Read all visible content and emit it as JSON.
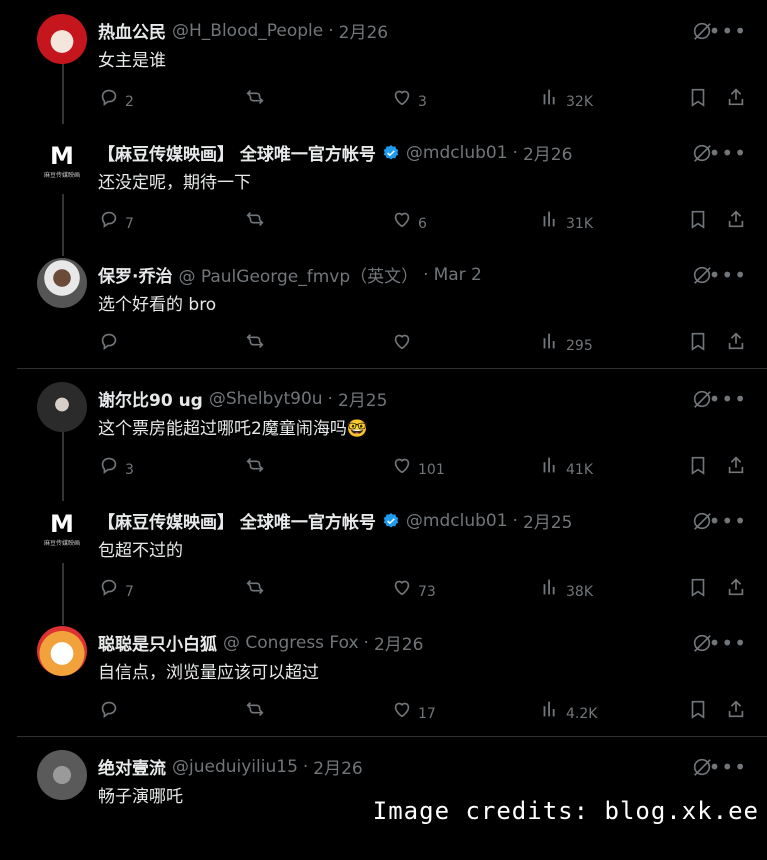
{
  "groups": [
    {
      "tweets": [
        {
          "name": "热血公民",
          "handle": "@H_Blood_People",
          "date": "2月26",
          "text": "女主是谁",
          "verified": false,
          "avatar": "red-rabbit-avatar",
          "reply": "2",
          "retweet": "",
          "like": "3",
          "views": "32K"
        },
        {
          "name": "【麻豆传媒映画】 全球唯一官方帐号",
          "handle": "@mdclub01",
          "date": "2月26",
          "text": "还没定呢，期待一下",
          "verified": true,
          "avatar": "madou-logo",
          "reply": "7",
          "retweet": "",
          "like": "6",
          "views": "31K"
        },
        {
          "name": "保罗·乔治",
          "handle": "@ PaulGeorge_fmvp（英文）",
          "date": "Mar 2",
          "text": "选个好看的 bro",
          "verified": false,
          "avatar": "man-photo-avatar",
          "reply": "",
          "retweet": "",
          "like": "",
          "views": "295"
        }
      ]
    },
    {
      "tweets": [
        {
          "name": "谢尔比90 ug",
          "handle": "@Shelbyt90u",
          "date": "2月25",
          "text": "这个票房能超过哪吒2魔童闹海吗🤓",
          "verified": false,
          "avatar": "dark-portrait-avatar",
          "reply": "3",
          "retweet": "",
          "like": "101",
          "views": "41K"
        },
        {
          "name": "【麻豆传媒映画】 全球唯一官方帐号",
          "handle": "@mdclub01",
          "date": "2月25",
          "text": "包超不过的",
          "verified": true,
          "avatar": "madou-logo",
          "reply": "7",
          "retweet": "",
          "like": "73",
          "views": "38K"
        },
        {
          "name": "聪聪是只小白狐",
          "handle": "@ Congress Fox",
          "date": "2月26",
          "text": "自信点，浏览量应该可以超过",
          "verified": false,
          "avatar": "fox-cartoon-avatar",
          "reply": "",
          "retweet": "",
          "like": "17",
          "views": "4.2K"
        }
      ]
    },
    {
      "tweets": [
        {
          "name": "绝对壹流",
          "handle": "@jueduiyiliu15",
          "date": "2月26",
          "text": "畅子演哪吒",
          "verified": false,
          "avatar": "statue-avatar",
          "reply": "",
          "retweet": "",
          "like": "",
          "views": ""
        }
      ]
    }
  ],
  "logo_text": {
    "letter": "M",
    "caption": "麻豆传媒映画"
  },
  "watermark": "Image credits: blog.xk.ee",
  "colors": {
    "background": "#000000",
    "text": "#e7e9ea",
    "muted": "#71767b",
    "verified": "#1d9bf0",
    "divider": "#2f3336"
  }
}
